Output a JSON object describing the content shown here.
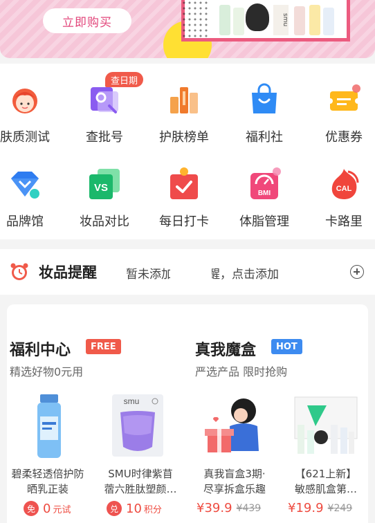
{
  "banner": {
    "buy_label": "立即购买",
    "brand_text": "smu"
  },
  "tools": [
    {
      "label": "肤质测试",
      "icon": "face-avatar-icon"
    },
    {
      "label": "查批号",
      "icon": "batch-search-icon",
      "tag": "查日期"
    },
    {
      "label": "护肤榜单",
      "icon": "ranking-chart-icon"
    },
    {
      "label": "福利社",
      "icon": "shopping-bag-icon"
    },
    {
      "label": "优惠券",
      "icon": "coupon-icon"
    },
    {
      "label": "品牌馆",
      "icon": "diamond-icon"
    },
    {
      "label": "妆品对比",
      "icon": "vs-compare-icon"
    },
    {
      "label": "每日打卡",
      "icon": "check-in-icon"
    },
    {
      "label": "体脂管理",
      "icon": "bmi-scale-icon"
    },
    {
      "label": "卡路里",
      "icon": "calorie-flame-icon"
    }
  ],
  "reminder": {
    "title": "妆品提醒",
    "hint": "暂未添加妆品提醒，点击添加"
  },
  "welfare": {
    "title": "福利中心",
    "badge": "FREE",
    "subtitle": "精选好物0元用",
    "products": [
      {
        "name_line1": "碧柔轻透倍护防",
        "name_line2": "晒乳正装",
        "tag": "免",
        "price": "0",
        "unit": "元试"
      },
      {
        "name_line1": "SMU时律紫苜",
        "name_line2": "蓿六胜肽塑颜…",
        "tag": "兑",
        "price": "10",
        "unit": "积分"
      }
    ]
  },
  "mystery": {
    "title": "真我魔盒",
    "badge": "HOT",
    "subtitle": "严选产品 限时抢购",
    "products": [
      {
        "name_line1": "真我盲盒3期·",
        "name_line2": "尽享拆盒乐趣",
        "price": "¥39.9",
        "old_price": "¥439"
      },
      {
        "name_line1": "【621上新】",
        "name_line2": "敏感肌盒第…",
        "price": "¥19.9",
        "old_price": "¥249"
      }
    ]
  },
  "colors": {
    "accent": "#ee4b40",
    "free_badge": "#f05a4a",
    "hot_badge": "#3d8bf0",
    "banner_pink": "#f6c6d8"
  }
}
